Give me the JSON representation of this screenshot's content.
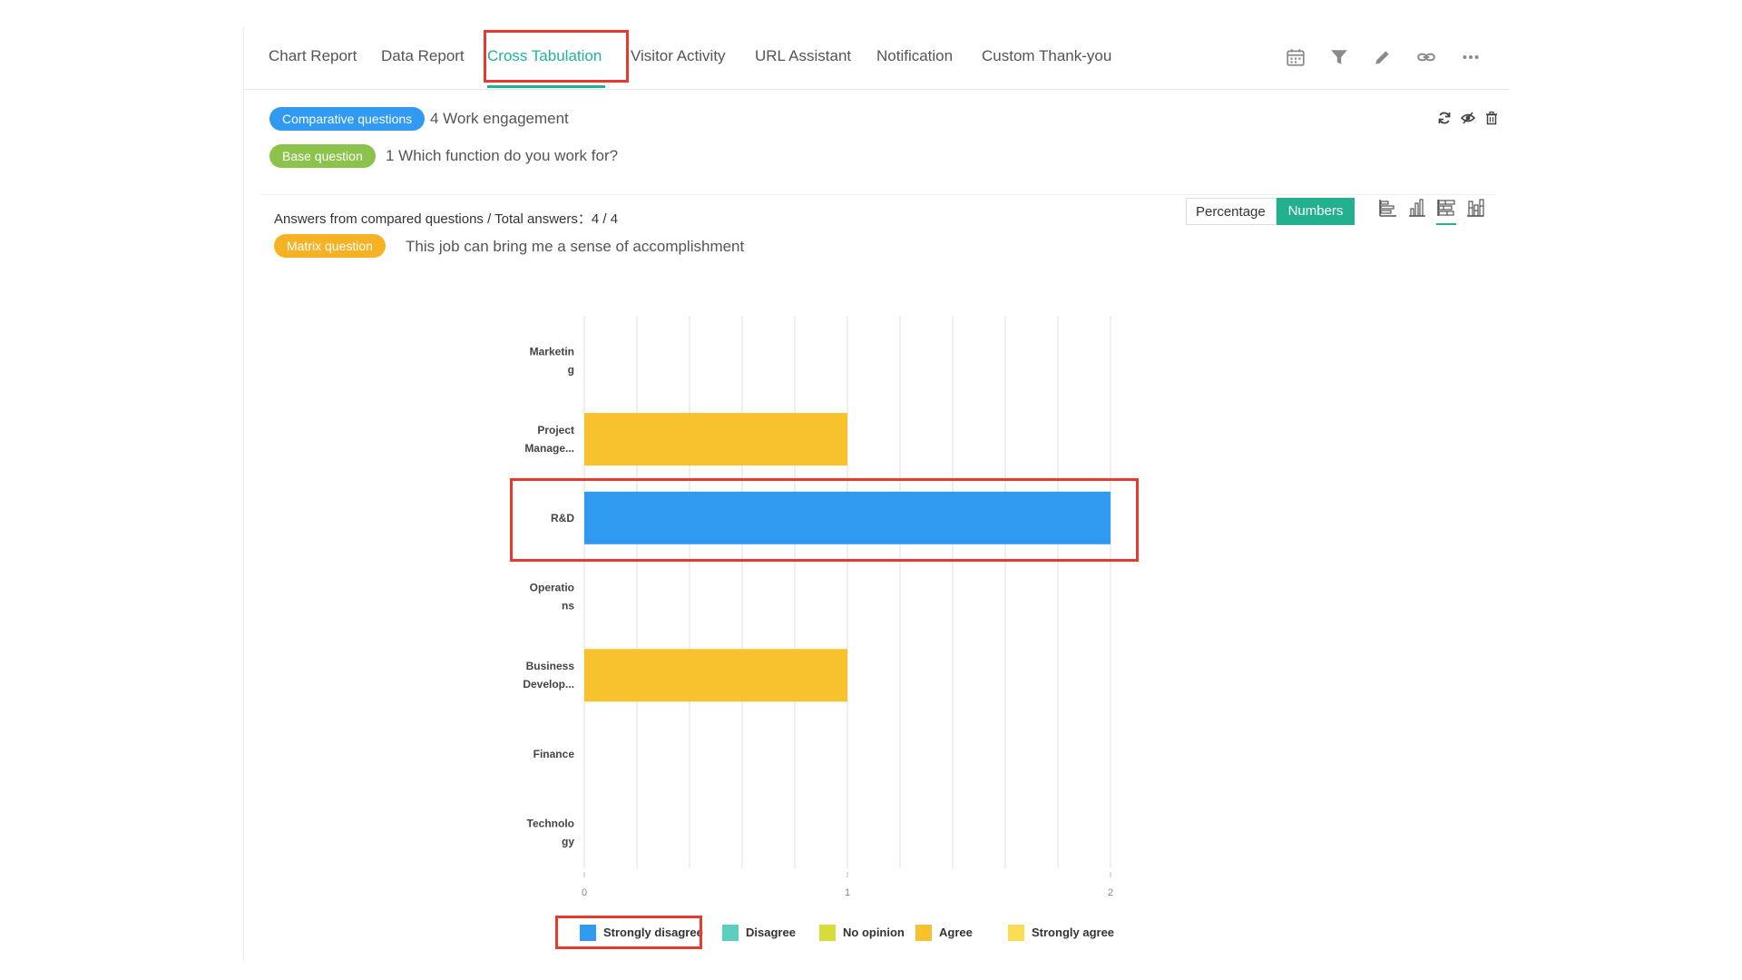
{
  "tabs": [
    {
      "label": "Chart Report",
      "active": false
    },
    {
      "label": "Data Report",
      "active": false
    },
    {
      "label": "Cross Tabulation",
      "active": true
    },
    {
      "label": "Visitor Activity",
      "active": false
    },
    {
      "label": "URL Assistant",
      "active": false
    },
    {
      "label": "Notification",
      "active": false
    },
    {
      "label": "Custom Thank-you",
      "active": false
    }
  ],
  "toolbar_icons": [
    "calendar-icon",
    "filter-icon",
    "pencil-icon",
    "link-icon",
    "more-icon"
  ],
  "comparative": {
    "badge": "Comparative questions",
    "text": "4 Work engagement"
  },
  "base": {
    "badge": "Base question",
    "text": "1 Which function do you work for?"
  },
  "card_actions": [
    "refresh-icon",
    "hide-icon",
    "trash-icon"
  ],
  "answers_summary": "Answers from compared questions / Total answers：4 / 4",
  "matrix": {
    "badge": "Matrix question",
    "text": "This job can bring me a sense of accomplishment"
  },
  "view_toggle": {
    "percentage": "Percentage",
    "numbers": "Numbers",
    "selected": "Numbers"
  },
  "chart_type_icons": [
    "horizontal-bar-icon",
    "vertical-bar-icon",
    "stacked-horizontal-bar-icon",
    "stacked-vertical-bar-icon"
  ],
  "colors": {
    "accent": "#1fb395",
    "highlight": "#e8392f"
  },
  "chart_data": {
    "type": "bar",
    "orientation": "horizontal",
    "stacked": true,
    "categories": [
      [
        "Marketin",
        "g"
      ],
      [
        "Project",
        "Manage..."
      ],
      [
        "R&D"
      ],
      [
        "Operatio",
        "ns"
      ],
      [
        "Business",
        "Develop..."
      ],
      [
        "Finance"
      ],
      [
        "Technolo",
        "gy"
      ]
    ],
    "series": [
      {
        "name": "Strongly disagree",
        "color": "#2f9af0",
        "values": [
          0,
          0,
          2,
          0,
          0,
          0,
          0
        ]
      },
      {
        "name": "Disagree",
        "color": "#5ccfc0",
        "values": [
          0,
          0,
          0,
          0,
          0,
          0,
          0
        ]
      },
      {
        "name": "No opinion",
        "color": "#d6dc3a",
        "values": [
          0,
          0,
          0,
          0,
          0,
          0,
          0
        ]
      },
      {
        "name": "Agree",
        "color": "#f8c22e",
        "values": [
          0,
          1,
          0,
          0,
          1,
          0,
          0
        ]
      },
      {
        "name": "Strongly agree",
        "color": "#f9dd52",
        "values": [
          0,
          0,
          0,
          0,
          0,
          0,
          0
        ]
      }
    ],
    "xlim": [
      0,
      2
    ],
    "xticks": [
      "0",
      "1",
      "2"
    ],
    "grid": true,
    "legend_position": "bottom"
  }
}
